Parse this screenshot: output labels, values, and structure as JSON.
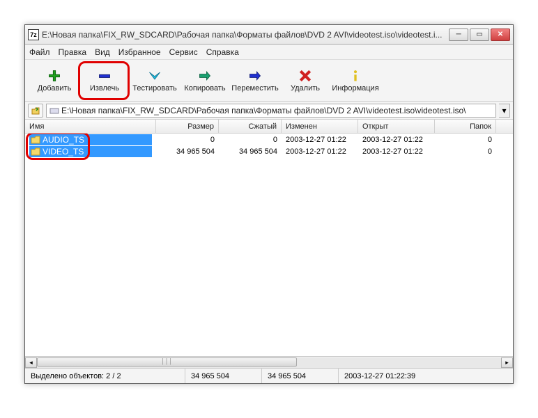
{
  "titlebar": {
    "icon_text": "7z",
    "title": "E:\\Новая папка\\FIX_RW_SDCARD\\Рабочая папка\\Форматы файлов\\DVD 2 AVI\\videotest.iso\\videotest.i..."
  },
  "menu": {
    "file": "Файл",
    "edit": "Правка",
    "view": "Вид",
    "favorites": "Избранное",
    "tools": "Сервис",
    "help": "Справка"
  },
  "toolbar": {
    "add": "Добавить",
    "extract": "Извлечь",
    "test": "Тестировать",
    "copy": "Копировать",
    "move": "Переместить",
    "delete": "Удалить",
    "info": "Информация"
  },
  "address": {
    "path": "E:\\Новая папка\\FIX_RW_SDCARD\\Рабочая папка\\Форматы файлов\\DVD 2 AVI\\videotest.iso\\videotest.iso\\"
  },
  "columns": {
    "name": "Имя",
    "size": "Размер",
    "packed": "Сжатый",
    "modified": "Изменен",
    "opened": "Открыт",
    "folders": "Папок"
  },
  "rows": [
    {
      "name": "AUDIO_TS",
      "size": "0",
      "packed": "0",
      "modified": "2003-12-27 01:22",
      "opened": "2003-12-27 01:22",
      "folders": "0"
    },
    {
      "name": "VIDEO_TS",
      "size": "34 965 504",
      "packed": "34 965 504",
      "modified": "2003-12-27 01:22",
      "opened": "2003-12-27 01:22",
      "folders": "0"
    }
  ],
  "status": {
    "selected": "Выделено объектов: 2 / 2",
    "size": "34 965 504",
    "packed": "34 965 504",
    "date": "2003-12-27 01:22:39"
  }
}
